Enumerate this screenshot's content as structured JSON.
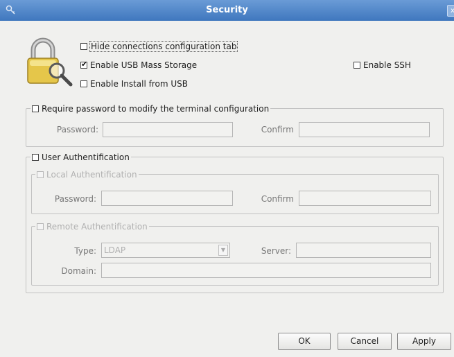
{
  "window": {
    "title": "Security",
    "close_glyph": "x"
  },
  "options": {
    "hide_tab": {
      "label": "Hide connections configuration tab",
      "checked": false
    },
    "usb_storage": {
      "label": "Enable USB Mass Storage",
      "checked": true
    },
    "install_usb": {
      "label": "Enable Install from USB",
      "checked": false
    },
    "ssh": {
      "label": "Enable SSH",
      "checked": false
    }
  },
  "terminal_pw": {
    "legend": "Require password to modify the terminal configuration",
    "checked": false,
    "password_label": "Password:",
    "password_value": "",
    "confirm_label": "Confirm",
    "confirm_value": ""
  },
  "user_auth": {
    "legend": "User Authentification",
    "checked": false,
    "local": {
      "legend": "Local Authentification",
      "checked": false,
      "password_label": "Password:",
      "password_value": "",
      "confirm_label": "Confirm",
      "confirm_value": ""
    },
    "remote": {
      "legend": "Remote Authentification",
      "checked": false,
      "type_label": "Type:",
      "type_value": "LDAP",
      "server_label": "Server:",
      "server_value": "",
      "domain_label": "Domain:",
      "domain_value": ""
    }
  },
  "buttons": {
    "ok": "OK",
    "cancel": "Cancel",
    "apply": "Apply"
  },
  "icons": {
    "window": "key-icon",
    "main": "padlock-magnifier-icon"
  },
  "colors": {
    "titlebar": "#4f86c8",
    "background": "#f0f0ee"
  }
}
